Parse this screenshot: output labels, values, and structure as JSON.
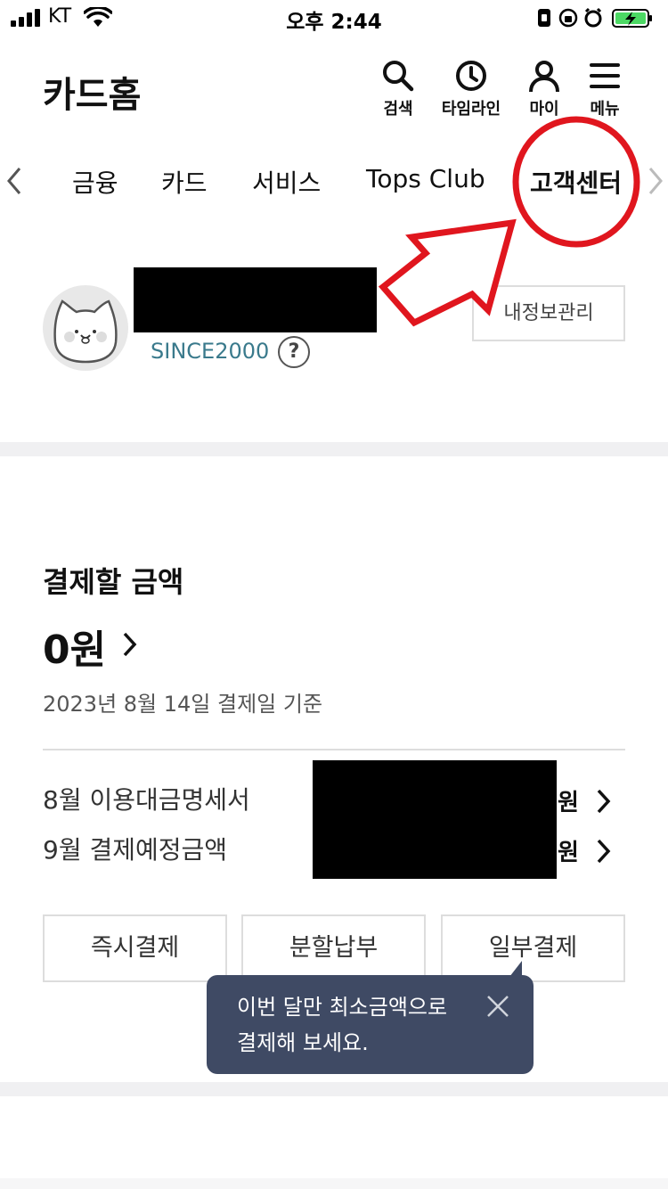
{
  "status_bar": {
    "carrier": "KT",
    "time": "오후 2:44"
  },
  "header": {
    "title": "카드홈",
    "actions": [
      {
        "label": "검색",
        "icon": "search-icon"
      },
      {
        "label": "타임라인",
        "icon": "clock-icon"
      },
      {
        "label": "마이",
        "icon": "person-icon"
      },
      {
        "label": "메뉴",
        "icon": "menu-icon"
      }
    ]
  },
  "tabs": [
    "금융",
    "카드",
    "서비스",
    "Tops Club",
    "고객센터"
  ],
  "profile": {
    "grade": "SINCE2000",
    "help_label": "?",
    "info_button": "내정보관리"
  },
  "payment": {
    "title": "결제할 금액",
    "amount": "0원",
    "date_note": "2023년 8월 14일 결제일 기준",
    "rows": [
      {
        "label": "8월 이용대금명세서",
        "unit": "원"
      },
      {
        "label": "9월 결제예정금액",
        "unit": "원"
      }
    ],
    "buttons": [
      "즉시결제",
      "분할납부",
      "일부결제"
    ]
  },
  "tooltip": {
    "text": "이번 달만 최소금액으로\n결제해 보세요."
  },
  "colors": {
    "accent_link": "#3a7a8c",
    "tooltip_bg": "#3f4a64",
    "annotation_red": "#e0161e"
  }
}
